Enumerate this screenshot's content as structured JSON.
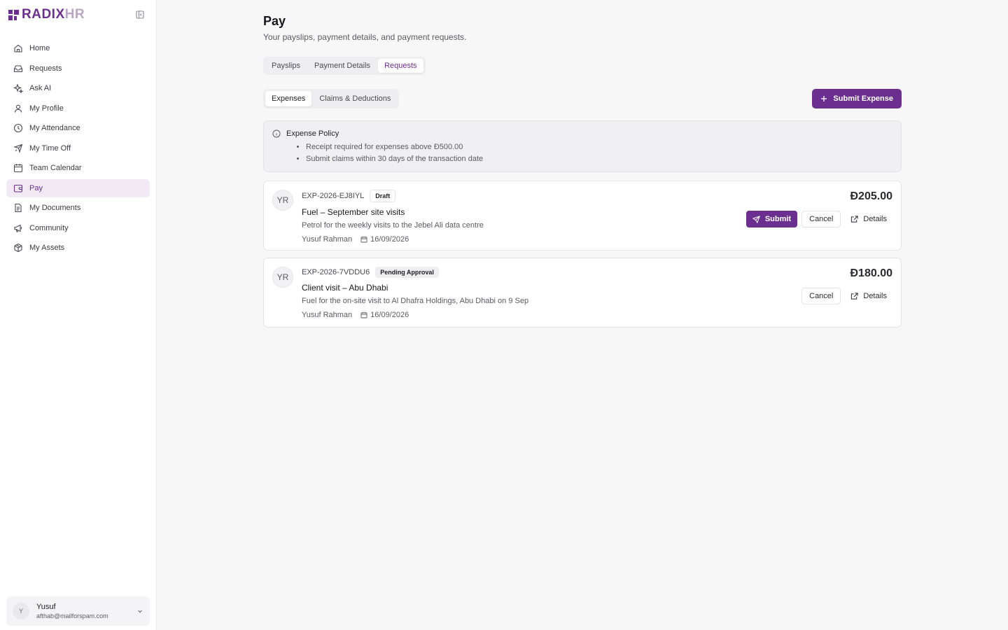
{
  "brand": {
    "name_primary": "RADIX",
    "name_secondary": "HR"
  },
  "sidebar": {
    "items": [
      {
        "label": "Home",
        "icon": "home-icon"
      },
      {
        "label": "Requests",
        "icon": "inbox-icon"
      },
      {
        "label": "Ask AI",
        "icon": "sparkles-icon"
      },
      {
        "label": "My Profile",
        "icon": "user-icon"
      },
      {
        "label": "My Attendance",
        "icon": "clock-icon"
      },
      {
        "label": "My Time Off",
        "icon": "plane-icon"
      },
      {
        "label": "Team Calendar",
        "icon": "calendar-icon"
      },
      {
        "label": "Pay",
        "icon": "wallet-icon",
        "active": true
      },
      {
        "label": "My Documents",
        "icon": "document-icon"
      },
      {
        "label": "Community",
        "icon": "megaphone-icon"
      },
      {
        "label": "My Assets",
        "icon": "box-icon"
      }
    ],
    "user": {
      "initial": "Y",
      "name": "Yusuf",
      "email": "afthab@mailforspam.com"
    }
  },
  "page": {
    "title": "Pay",
    "subtitle": "Your payslips, payment details, and payment requests.",
    "tabs": [
      "Payslips",
      "Payment Details",
      "Requests"
    ],
    "active_tab": "Requests",
    "subtabs": [
      "Expenses",
      "Claims & Deductions"
    ],
    "active_subtab": "Expenses",
    "submit_expense_label": "Submit Expense"
  },
  "policy": {
    "title": "Expense Policy",
    "items": [
      "Receipt required for expenses above Đ500.00",
      "Submit claims within 30 days of the transaction date"
    ]
  },
  "expenses": [
    {
      "avatar": "YR",
      "id": "EXP-2026-EJ8IYL",
      "status": "Draft",
      "title": "Fuel – September site visits",
      "description": "Petrol for the weekly visits to the Jebel Ali data centre",
      "employee": "Yusuf Rahman",
      "date": "16/09/2026",
      "amount": "Đ205.00",
      "actions": {
        "submit": "Submit",
        "cancel": "Cancel",
        "details": "Details"
      }
    },
    {
      "avatar": "YR",
      "id": "EXP-2026-7VDDU6",
      "status": "Pending Approval",
      "title": "Client visit – Abu Dhabi",
      "description": "Fuel for the on-site visit to Al Dhafra Holdings, Abu Dhabi on 9 Sep",
      "employee": "Yusuf Rahman",
      "date": "16/09/2026",
      "amount": "Đ180.00",
      "actions": {
        "cancel": "Cancel",
        "details": "Details"
      }
    }
  ],
  "colors": {
    "accent": "#6b2f8f",
    "accent_soft": "#f1eaf5"
  }
}
